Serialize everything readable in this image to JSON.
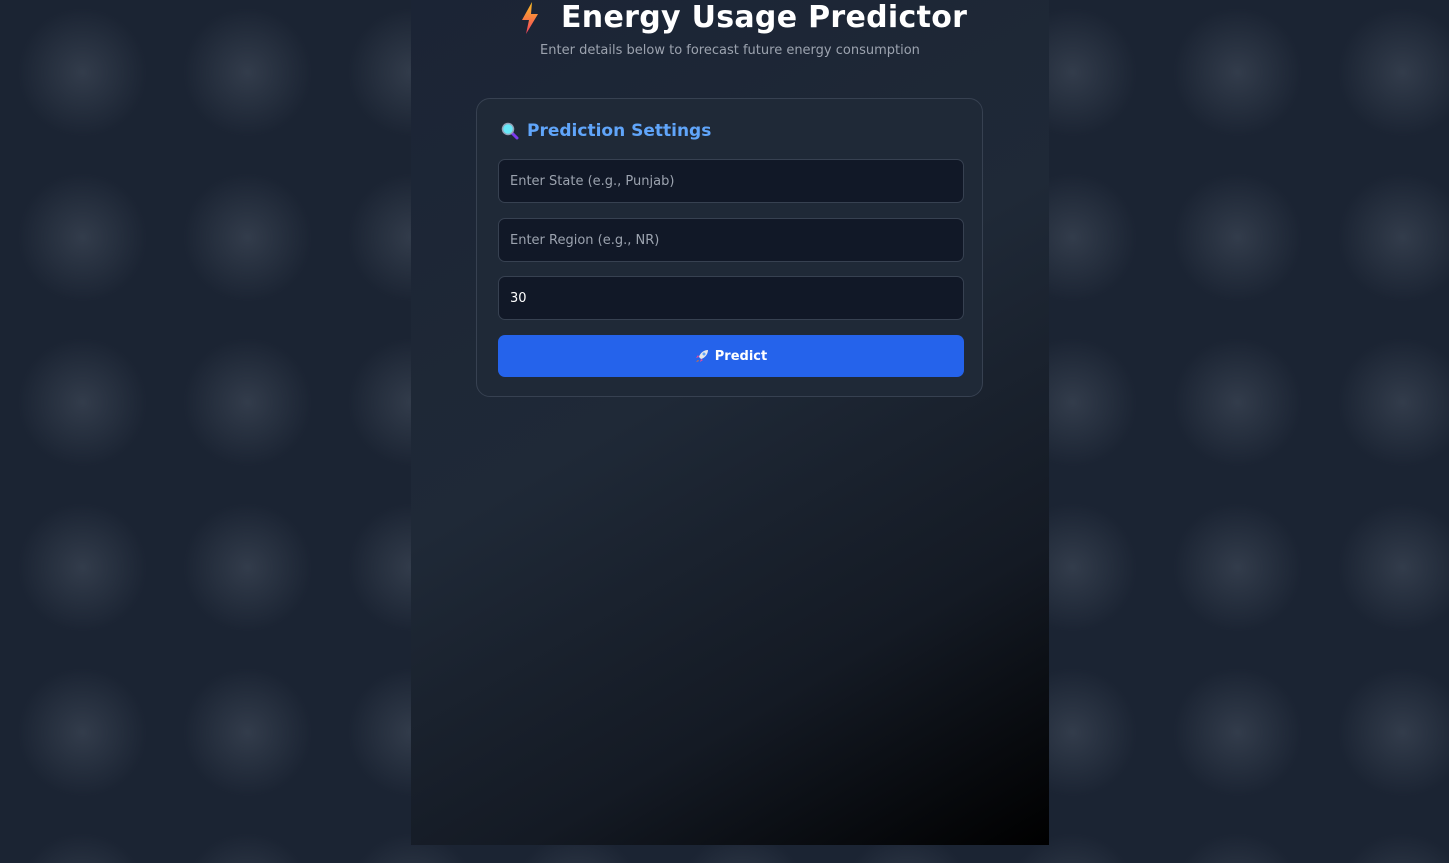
{
  "header": {
    "title": "Energy Usage Predictor",
    "subtitle": "Enter details below to forecast future energy consumption",
    "icon": "lightning-bolt-icon"
  },
  "card": {
    "title": "Prediction Settings",
    "icon": "magnifier-icon",
    "state_input": {
      "placeholder": "Enter State (e.g., Punjab)",
      "value": ""
    },
    "region_input": {
      "placeholder": "Enter Region (e.g., NR)",
      "value": ""
    },
    "days_input": {
      "value": "30"
    },
    "predict_button": {
      "label": "Predict",
      "icon": "rocket-icon"
    }
  },
  "colors": {
    "accent": "#2563eb",
    "title_blue": "#60a5fa",
    "card_bg": "#1f2937",
    "input_bg": "#111827"
  }
}
